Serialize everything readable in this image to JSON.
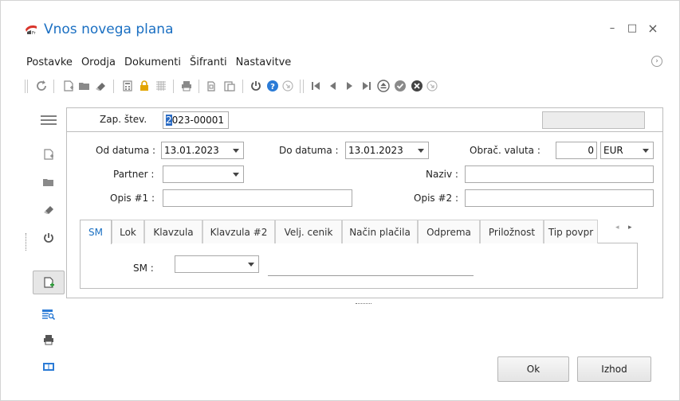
{
  "window": {
    "title": "Vnos novega plana",
    "minimize_label": "–",
    "maximize_label": "□",
    "close_label": "×"
  },
  "menu": {
    "items": [
      "Postavke",
      "Orodja",
      "Dokumenti",
      "Šifranti",
      "Nastavitve"
    ]
  },
  "toolbar": {
    "icons": [
      "refresh-icon",
      "new-document-icon",
      "open-folder-icon",
      "eraser-icon",
      "calculator-icon",
      "lock-icon",
      "grid-icon",
      "print-icon",
      "copy-icon",
      "paste-icon",
      "power-icon",
      "help-icon",
      "expand-icon",
      "first-record-icon",
      "previous-record-icon",
      "next-record-icon",
      "last-record-icon",
      "eject-icon",
      "confirm-icon",
      "cancel-icon",
      "expand-icon"
    ]
  },
  "side_rail": {
    "icons": [
      "menu-icon",
      "new-document-icon",
      "open-folder-icon",
      "eraser-icon",
      "power-icon",
      "add-document-icon",
      "table-search-icon",
      "print-icon",
      "panel-icon"
    ]
  },
  "form": {
    "zap_stev_label": "Zap. štev.",
    "zap_stev_value_cursor": "2",
    "zap_stev_value_rest": "023-00001",
    "od_datuma_label": "Od datuma :",
    "od_datuma_value": "13.01.2023",
    "do_datuma_label": "Do datuma :",
    "do_datuma_value": "13.01.2023",
    "obrac_valuta_label": "Obrač. valuta :",
    "obrac_valuta_amount": "0",
    "obrac_valuta_currency": "EUR",
    "partner_label": "Partner :",
    "partner_value": "",
    "naziv_label": "Naziv :",
    "naziv_value": "",
    "opis1_label": "Opis #1 :",
    "opis1_value": "",
    "opis2_label": "Opis #2 :",
    "opis2_value": ""
  },
  "tabs": {
    "items": [
      "SM",
      "Lok",
      "Klavzula",
      "Klavzula #2",
      "Velj. cenik",
      "Način plačila",
      "Odprema",
      "Priložnost",
      "Tip povpr"
    ],
    "active": "SM",
    "scroll_left": "◂",
    "scroll_right": "▸"
  },
  "tab_sm": {
    "sm_label": "SM :",
    "sm_value": ""
  },
  "buttons": {
    "ok_label": "Ok",
    "izhod_label": "Izhod"
  },
  "colors": {
    "title": "#1a6fc2",
    "active_tab": "#1a6fc2",
    "help_icon": "#2b7bd6",
    "lock_icon": "#e2a400"
  }
}
